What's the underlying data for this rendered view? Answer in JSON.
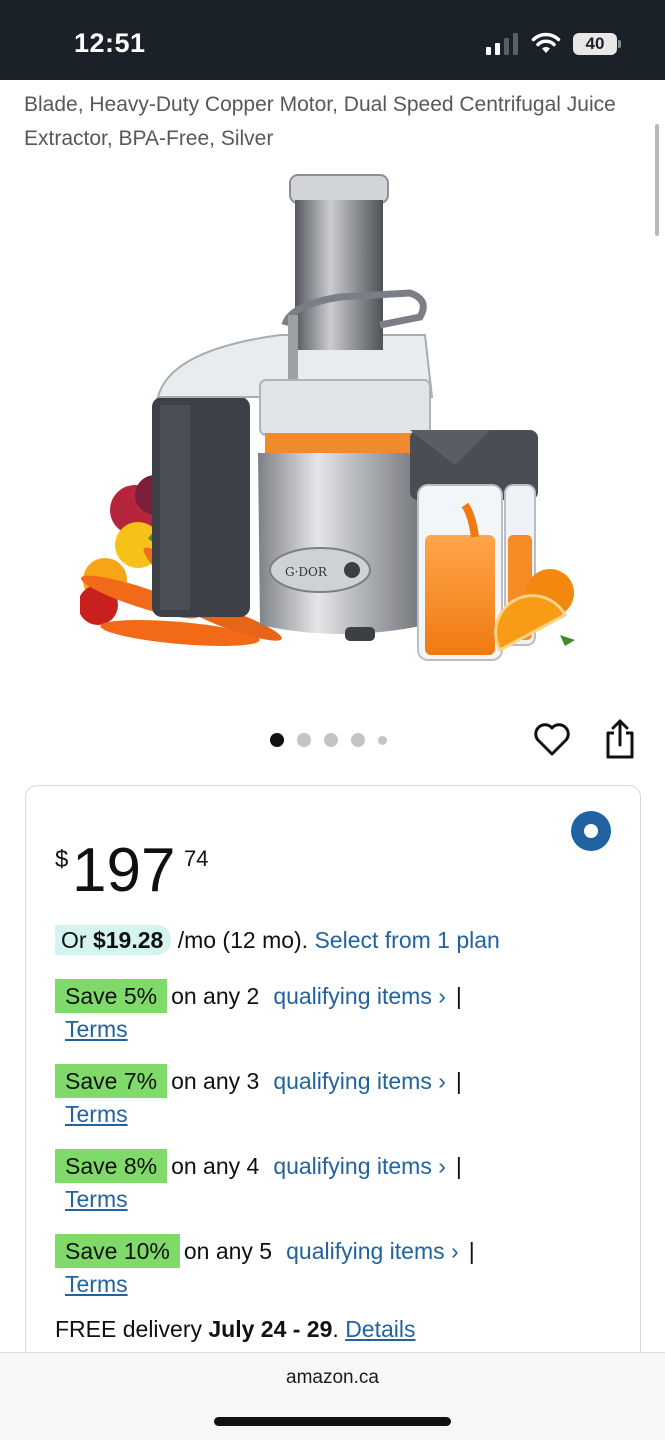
{
  "status_bar": {
    "time": "12:51",
    "battery": "40"
  },
  "product": {
    "title": "Blade, Heavy-Duty Copper Motor, Dual Speed Centrifugal Juice Extractor, BPA-Free, Silver",
    "brand_on_image": "G·DOR",
    "image_dots": 5,
    "active_dot": 0
  },
  "icons": {
    "wishlist": "heart-icon",
    "share": "share-icon"
  },
  "price": {
    "symbol": "$",
    "whole": "197",
    "fraction": "74"
  },
  "installment": {
    "prefix": "Or ",
    "amount": "$19.28",
    "suffix": "/mo (12 mo). ",
    "link": "Select from 1 plan"
  },
  "promotions": [
    {
      "badge": "Save 5%",
      "text": "on any 2",
      "link": "qualifying items ›",
      "pipe": "|",
      "terms": "Terms"
    },
    {
      "badge": "Save 7%",
      "text": "on any 3",
      "link": "qualifying items ›",
      "pipe": "|",
      "terms": "Terms"
    },
    {
      "badge": "Save 8%",
      "text": "on any 4",
      "link": "qualifying items ›",
      "pipe": "|",
      "terms": "Terms"
    },
    {
      "badge": "Save 10%",
      "text": "on any 5",
      "link": "qualifying items ›",
      "pipe": "|",
      "terms": "Terms"
    }
  ],
  "delivery": {
    "prefix": "FREE delivery ",
    "dates": "July 24 - 29",
    "dot": ". ",
    "details": "Details"
  },
  "browser": {
    "url": "amazon.ca"
  },
  "colors": {
    "link": "#2162a1",
    "save_badge": "#7fda69",
    "installment_bg": "#d4f5ef",
    "status_bar": "#1b2129"
  }
}
